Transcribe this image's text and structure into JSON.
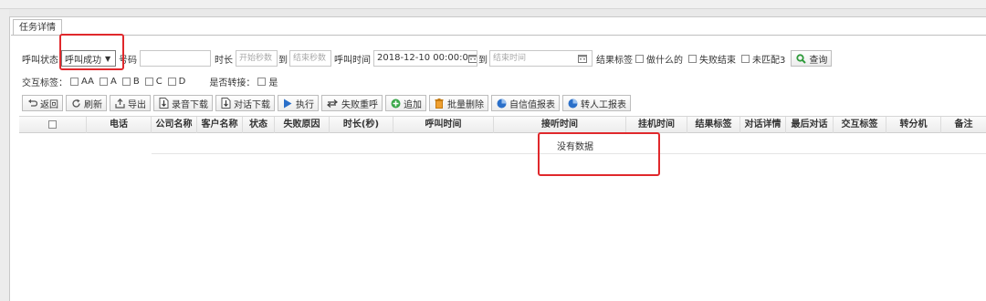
{
  "tab": {
    "label": "任务详情"
  },
  "filters": {
    "call_status_label": "呼叫状态",
    "call_status_value": "呼叫成功",
    "number_label": "号码",
    "duration_label": "时长",
    "duration_start_placeholder": "开始秒数",
    "duration_to": "到",
    "duration_end_placeholder": "结束秒数",
    "call_time_label": "呼叫时间",
    "call_time_start": "2018-12-10 00:00:0",
    "call_time_to": "到",
    "call_time_end_placeholder": "结束时间",
    "result_tag_label": "结果标签",
    "result_tags": [
      "做什么的",
      "失败结束",
      "未匹配3"
    ],
    "query_label": "查询",
    "interaction_tag_label": "交互标签：",
    "interaction_tags": [
      "AA",
      "A",
      "B",
      "C",
      "D"
    ],
    "transfer_label": "是否转接：",
    "transfer_option": "是"
  },
  "toolbar": {
    "back": "返回",
    "refresh": "刷新",
    "export": "导出",
    "download_recording": "录音下载",
    "download_dialog": "对话下载",
    "execute": "执行",
    "retry_failed": "失败重呼",
    "add": "追加",
    "batch_delete": "批量删除",
    "credit_report": "自信值报表",
    "transfer_report": "转人工报表"
  },
  "table": {
    "columns": [
      "电话",
      "公司名称",
      "客户名称",
      "状态",
      "失败原因",
      "时长(秒)",
      "呼叫时间",
      "接听时间",
      "挂机时间",
      "结果标签",
      "对话详情",
      "最后对话",
      "交互标签",
      "转分机",
      "备注"
    ],
    "empty_text": "没有数据"
  },
  "colors": {
    "highlight": "#e0282c",
    "query_icon": "#2e9a3a",
    "play_icon": "#2a6fc9"
  }
}
